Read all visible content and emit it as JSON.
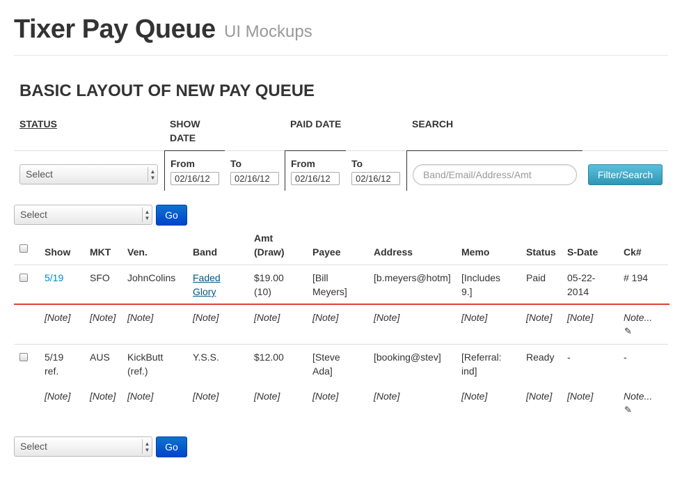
{
  "header": {
    "title": "Tixer Pay Queue",
    "subtitle": "UI Mockups"
  },
  "section_title": "BASIC LAYOUT OF NEW PAY QUEUE",
  "filters": {
    "status_label": "STATUS",
    "show_label_1": "SHOW",
    "show_label_2": "DATE",
    "paid_label": "PAID DATE",
    "search_label": "SEARCH",
    "status_select": "Select",
    "show_from_label": "From",
    "show_from_value": "02/16/12",
    "show_to_label": "To",
    "show_to_value": "02/16/12",
    "paid_from_label": "From",
    "paid_from_value": "02/16/12",
    "paid_to_label": "To",
    "paid_to_value": "02/16/12",
    "search_placeholder": "Band/Email/Address/Amt",
    "filter_button": "Filter/Search"
  },
  "bulk_top": {
    "select": "Select",
    "go": "Go"
  },
  "bulk_bottom": {
    "select": "Select",
    "go": "Go"
  },
  "table": {
    "headers": {
      "show": "Show",
      "mkt": "MKT",
      "ven": "Ven.",
      "band": "Band",
      "amt_1": "Amt",
      "amt_2": "(Draw)",
      "payee": "Payee",
      "address": "Address",
      "memo": "Memo",
      "status": "Status",
      "sdate": "S-Date",
      "ck": "Ck#"
    },
    "rows": [
      {
        "show": "5/19",
        "show2": "",
        "mkt": "SFO",
        "ven": "JohnColins",
        "ven2": "",
        "band": "Faded",
        "band2": "Glory",
        "amt": "$19.00",
        "amt2": "(10)",
        "payee": "[Bill",
        "payee2": "Meyers]",
        "address": "[b.meyers@hotm]",
        "memo": "[Includes",
        "memo2": "9.]",
        "status": "Paid",
        "sdate": "05-22-",
        "sdate2": "2014",
        "ck": "# 194"
      },
      {
        "show": "5/19",
        "show2": "ref.",
        "mkt": "AUS",
        "ven": "KickButt",
        "ven2": "(ref.)",
        "band": "Y.S.S.",
        "band2": "",
        "amt": "$12.00",
        "amt2": "",
        "payee": "[Steve",
        "payee2": "Ada]",
        "address": "[booking@stev]",
        "memo": "[Referral:",
        "memo2": "ind]",
        "status": "Ready",
        "sdate": "-",
        "sdate2": "",
        "ck": "-"
      }
    ],
    "note": "[Note]",
    "note_link": "Note..."
  }
}
